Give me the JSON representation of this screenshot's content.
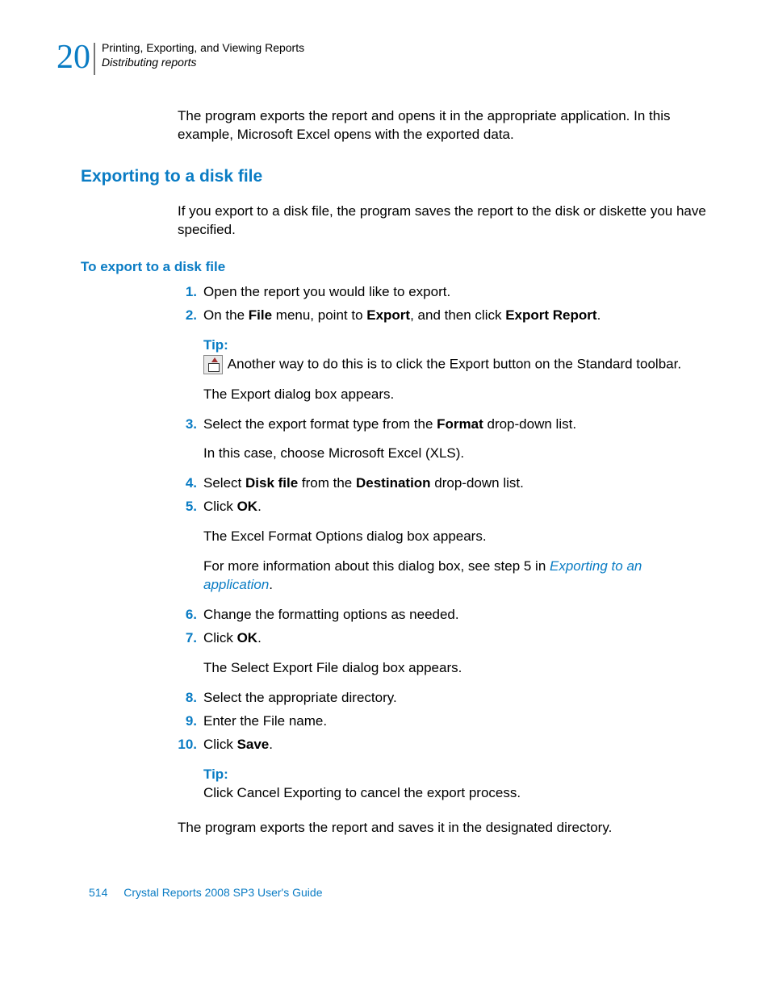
{
  "header": {
    "chapter_number": "20",
    "chapter_title": "Printing, Exporting, and Viewing Reports",
    "section_title": "Distributing reports"
  },
  "intro": {
    "para1": "The program exports the report and opens it in the appropriate application. In this example, Microsoft Excel opens with the exported data."
  },
  "section": {
    "heading": "Exporting to a disk file",
    "para": "If you export to a disk file, the program saves the report to the disk or diskette you have specified.",
    "subheading": "To export to a disk file"
  },
  "steps": {
    "s1": {
      "num": "1.",
      "text_a": "Open the report you would like to export."
    },
    "s2": {
      "num": "2.",
      "text_a": "On the ",
      "b1": "File",
      "text_b": " menu, point to ",
      "b2": "Export",
      "text_c": ", and then click ",
      "b3": "Export Report",
      "text_d": ".",
      "tip_label": "Tip:",
      "tip_text": " Another way to do this is to click the Export button on the Standard toolbar.",
      "after": "The Export dialog box appears."
    },
    "s3": {
      "num": "3.",
      "text_a": "Select the export format type from the ",
      "b1": "Format",
      "text_b": " drop-down list.",
      "after": "In this case, choose Microsoft Excel (XLS)."
    },
    "s4": {
      "num": "4.",
      "text_a": "Select ",
      "b1": "Disk file",
      "text_b": " from the ",
      "b2": "Destination",
      "text_c": " drop-down list."
    },
    "s5": {
      "num": "5.",
      "text_a": "Click ",
      "b1": "OK",
      "text_b": ".",
      "after1": "The Excel Format Options dialog box appears.",
      "after2_a": "For more information about this dialog box, see step 5 in ",
      "after2_link": "Exporting to an application",
      "after2_b": "."
    },
    "s6": {
      "num": "6.",
      "text_a": "Change the formatting options as needed."
    },
    "s7": {
      "num": "7.",
      "text_a": "Click ",
      "b1": "OK",
      "text_b": ".",
      "after": "The Select Export File dialog box appears."
    },
    "s8": {
      "num": "8.",
      "text_a": "Select the appropriate directory."
    },
    "s9": {
      "num": "9.",
      "text_a": "Enter the File name."
    },
    "s10": {
      "num": "10.",
      "text_a": "Click ",
      "b1": "Save",
      "text_b": ".",
      "tip_label": "Tip:",
      "tip_text": "Click Cancel Exporting to cancel the export process."
    }
  },
  "closing": {
    "para": "The program exports the report and saves it in the designated directory."
  },
  "footer": {
    "page": "514",
    "doc": "Crystal Reports 2008 SP3 User's Guide"
  }
}
